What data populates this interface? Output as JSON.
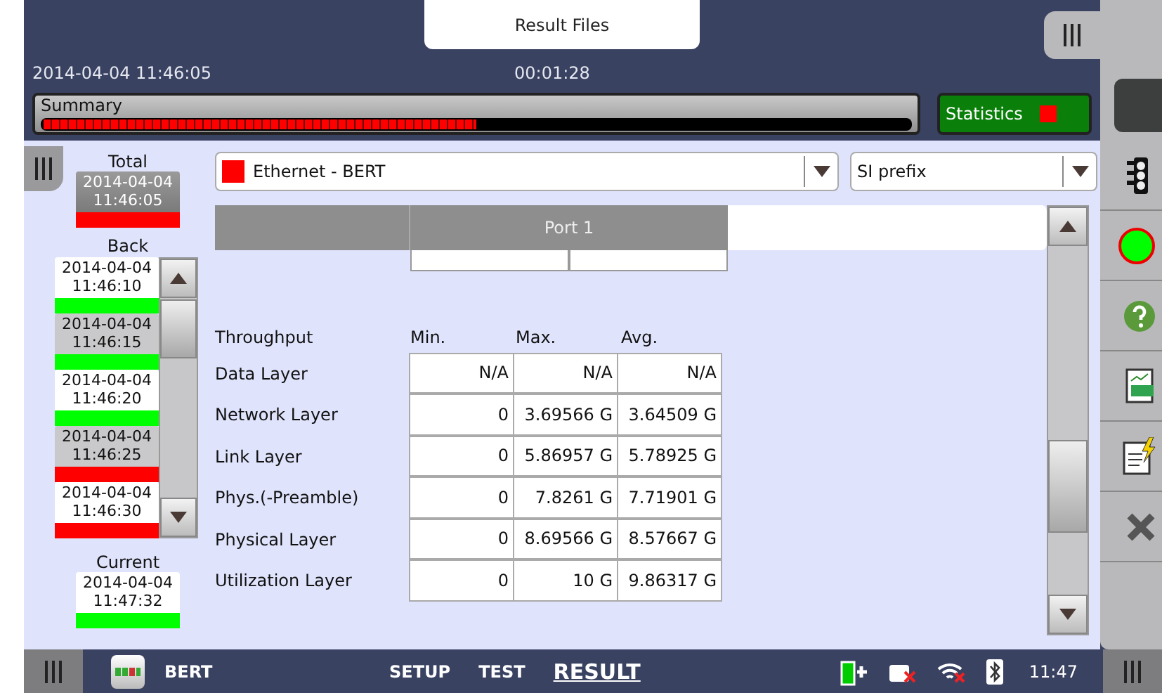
{
  "header": {
    "tab_title": "Result Files",
    "datetime": "2014-04-04 11:46:05",
    "elapsed": "00:01:28",
    "summary": {
      "label": "Summary",
      "level": 0.5
    },
    "statistics": {
      "label": "Statistics",
      "color": "#ff0000"
    }
  },
  "history": {
    "total": {
      "label": "Total",
      "entry": {
        "date": "2014-04-04",
        "time": "11:46:05",
        "color": "#ff0000",
        "selected": true
      }
    },
    "back": {
      "label": "Back",
      "items": [
        {
          "date": "2014-04-04",
          "time": "11:46:10",
          "color": "#00ff00",
          "selected": false
        },
        {
          "date": "2014-04-04",
          "time": "11:46:15",
          "color": "#00ff00",
          "selected": false
        },
        {
          "date": "2014-04-04",
          "time": "11:46:20",
          "color": "#00ff00",
          "selected": false
        },
        {
          "date": "2014-04-04",
          "time": "11:46:25",
          "color": "#ff0000",
          "selected": false
        },
        {
          "date": "2014-04-04",
          "time": "11:46:30",
          "color": "#ff0000",
          "selected": false
        }
      ]
    },
    "current": {
      "label": "Current",
      "entry": {
        "date": "2014-04-04",
        "time": "11:47:32",
        "color": "#00ff00",
        "selected": false
      }
    }
  },
  "selectors": [
    {
      "value": "Ethernet - BERT",
      "color": "#ff0000"
    },
    {
      "value": "SI prefix"
    }
  ],
  "table": {
    "group_header": "Port 1",
    "section": "Throughput",
    "columns": [
      "Min.",
      "Max.",
      "Avg."
    ],
    "rows": [
      {
        "label": "Data Layer",
        "values": [
          "N/A",
          "N/A",
          "N/A"
        ]
      },
      {
        "label": "Network Layer",
        "values": [
          "0",
          "3.69566 G",
          "3.64509 G"
        ]
      },
      {
        "label": "Link Layer",
        "values": [
          "0",
          "5.86957 G",
          "5.78925 G"
        ]
      },
      {
        "label": "Phys.(-Preamble)",
        "values": [
          "0",
          "7.8261 G",
          "7.71901 G"
        ]
      },
      {
        "label": "Physical Layer",
        "values": [
          "0",
          "8.69566 G",
          "8.57667 G"
        ]
      },
      {
        "label": "Utilization Layer",
        "values": [
          "0",
          "10 G",
          "9.86317 G"
        ]
      }
    ]
  },
  "status_bar": {
    "app": "BERT",
    "tabs": [
      {
        "label": "SETUP",
        "selected": false
      },
      {
        "label": "TEST",
        "selected": false
      },
      {
        "label": "RESULT",
        "selected": true
      }
    ],
    "time": "11:47"
  }
}
